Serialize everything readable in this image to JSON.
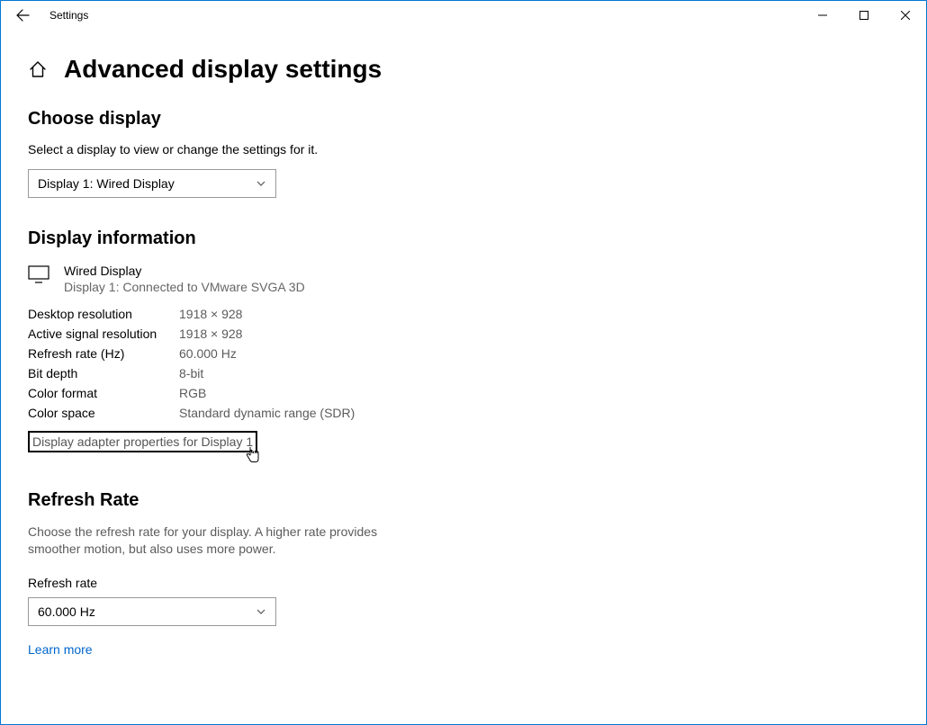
{
  "titlebar": {
    "title": "Settings"
  },
  "page": {
    "title": "Advanced display settings"
  },
  "choose": {
    "heading": "Choose display",
    "desc": "Select a display to view or change the settings for it.",
    "selected": "Display 1: Wired Display"
  },
  "info": {
    "heading": "Display information",
    "device_name": "Wired Display",
    "device_sub": "Display 1: Connected to VMware SVGA 3D",
    "rows": [
      {
        "k": "Desktop resolution",
        "v": "1918 × 928"
      },
      {
        "k": "Active signal resolution",
        "v": "1918 × 928"
      },
      {
        "k": "Refresh rate (Hz)",
        "v": "60.000 Hz"
      },
      {
        "k": "Bit depth",
        "v": "8-bit"
      },
      {
        "k": "Color format",
        "v": "RGB"
      },
      {
        "k": "Color space",
        "v": "Standard dynamic range (SDR)"
      }
    ],
    "adapter_link": "Display adapter properties for Display 1"
  },
  "refresh": {
    "heading": "Refresh Rate",
    "desc": "Choose the refresh rate for your display. A higher rate provides smoother motion, but also uses more power.",
    "label": "Refresh rate",
    "selected": "60.000 Hz",
    "learn_more": "Learn more"
  }
}
